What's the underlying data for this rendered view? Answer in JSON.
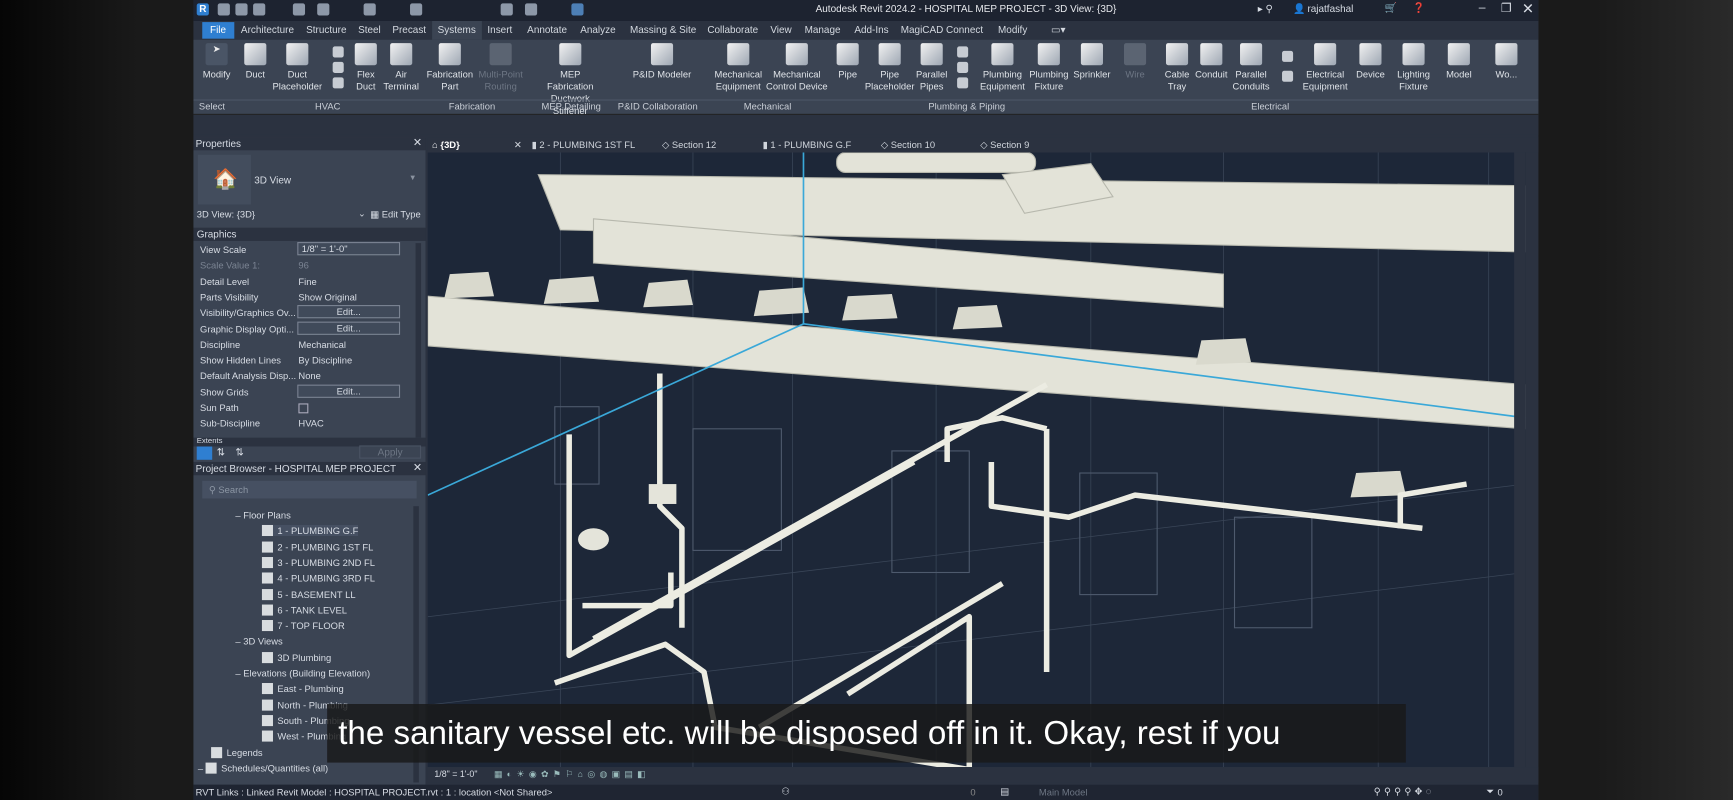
{
  "titlebar": {
    "title": "Autodesk Revit 2024.2 - HOSPITAL MEP PROJECT - 3D View: {3D}",
    "user": "rajatfashal"
  },
  "menu": [
    "File",
    "Architecture",
    "Structure",
    "Steel",
    "Precast",
    "Systems",
    "Insert",
    "Annotate",
    "Analyze",
    "Massing & Site",
    "Collaborate",
    "View",
    "Manage",
    "Add-Ins",
    "MagiCAD Connect",
    "Modify"
  ],
  "ribbon": {
    "buttons": [
      {
        "l1": "Modify",
        "l2": ""
      },
      {
        "l1": "Duct",
        "l2": ""
      },
      {
        "l1": "Duct",
        "l2": "Placeholder"
      },
      {
        "l1": "Flex",
        "l2": "Duct"
      },
      {
        "l1": "Air",
        "l2": "Terminal"
      },
      {
        "l1": "Fabrication",
        "l2": "Part"
      },
      {
        "l1": "Multi-Point",
        "l2": "Routing",
        "disabled": true
      },
      {
        "l1": "MEP Fabrication",
        "l2": "Ductwork Stiffener"
      },
      {
        "l1": "P&ID Modeler",
        "l2": ""
      },
      {
        "l1": "Mechanical",
        "l2": "Equipment"
      },
      {
        "l1": "Mechanical",
        "l2": "Control Device"
      },
      {
        "l1": "Pipe",
        "l2": ""
      },
      {
        "l1": "Pipe",
        "l2": "Placeholder"
      },
      {
        "l1": "Parallel",
        "l2": "Pipes"
      },
      {
        "l1": "Plumbing",
        "l2": "Equipment"
      },
      {
        "l1": "Plumbing",
        "l2": "Fixture"
      },
      {
        "l1": "Sprinkler",
        "l2": ""
      },
      {
        "l1": "Wire",
        "l2": "",
        "disabled": true
      },
      {
        "l1": "Cable",
        "l2": "Tray"
      },
      {
        "l1": "Conduit",
        "l2": ""
      },
      {
        "l1": "Parallel",
        "l2": "Conduits"
      },
      {
        "l1": "Electrical",
        "l2": "Equipment"
      },
      {
        "l1": "Device",
        "l2": ""
      },
      {
        "l1": "Lighting",
        "l2": "Fixture"
      },
      {
        "l1": "Model",
        "l2": ""
      },
      {
        "l1": "Wo...",
        "l2": ""
      }
    ],
    "groups": [
      "Select",
      "HVAC",
      "Fabrication",
      "MEP Detailing",
      "P&ID Collaboration",
      "Mechanical",
      "Plumbing & Piping",
      "Electrical"
    ]
  },
  "properties": {
    "title": "Properties",
    "type": "3D View",
    "selector": "3D View: {3D}",
    "edit_type": "Edit Type",
    "section": "Graphics",
    "next_section": "Extents",
    "apply": "Apply",
    "rows": [
      {
        "k": "View Scale",
        "v": "1/8\" = 1'-0\"",
        "kind": "input"
      },
      {
        "k": "Scale Value    1:",
        "v": "96",
        "kind": "dim"
      },
      {
        "k": "Detail Level",
        "v": "Fine"
      },
      {
        "k": "Parts Visibility",
        "v": "Show Original"
      },
      {
        "k": "Visibility/Graphics Ov...",
        "v": "Edit...",
        "kind": "button"
      },
      {
        "k": "Graphic Display Opti...",
        "v": "Edit...",
        "kind": "button"
      },
      {
        "k": "Discipline",
        "v": "Mechanical"
      },
      {
        "k": "Show Hidden Lines",
        "v": "By Discipline"
      },
      {
        "k": "Default Analysis Disp...",
        "v": "None"
      },
      {
        "k": "Show Grids",
        "v": "Edit...",
        "kind": "button"
      },
      {
        "k": "Sun Path",
        "v": "",
        "kind": "checkbox",
        "checked": false
      },
      {
        "k": "Sub-Discipline",
        "v": "HVAC"
      }
    ]
  },
  "browser": {
    "title": "Project Browser - HOSPITAL MEP PROJECT",
    "search_placeholder": "Search",
    "floor_plans": "Floor Plans",
    "plans": [
      "1 - PLUMBING G.F",
      "2 - PLUMBING 1ST FL",
      "3 - PLUMBING 2ND FL",
      "4 - PLUMBING 3RD FL",
      "5 - BASEMENT LL",
      "6 - TANK LEVEL",
      "7 - TOP FLOOR"
    ],
    "views_3d": "3D Views",
    "views_3d_items": [
      "3D Plumbing"
    ],
    "elevations": "Elevations (Building Elevation)",
    "elevation_items": [
      "East - Plumbing",
      "North - Plumbing",
      "South - Plumbing",
      "West - Plumbing"
    ],
    "legends": "Legends",
    "schedules": "Schedules/Quantities (all)"
  },
  "tabs": [
    {
      "label": "{3D}",
      "active": true
    },
    {
      "label": "2 - PLUMBING 1ST FL"
    },
    {
      "label": "Section 12"
    },
    {
      "label": "1 - PLUMBING G.F"
    },
    {
      "label": "Section 10"
    },
    {
      "label": "Section 9"
    }
  ],
  "view_control": {
    "scale": "1/8\" = 1'-0\""
  },
  "status": {
    "text": "RVT Links : Linked Revit Model : HOSPITAL PROJECT.rvt : 1 : location <Not Shared>",
    "model": "Main Model",
    "zero1": "0",
    "filter_count": "0"
  },
  "subtitle": "the sanitary vessel etc. will be disposed off in it. Okay, rest if you",
  "colors": {
    "accent": "#2f7fd1",
    "viewport": "#1d2738",
    "pipe": "#e7e7dc",
    "section_line": "#3aa8d8"
  }
}
